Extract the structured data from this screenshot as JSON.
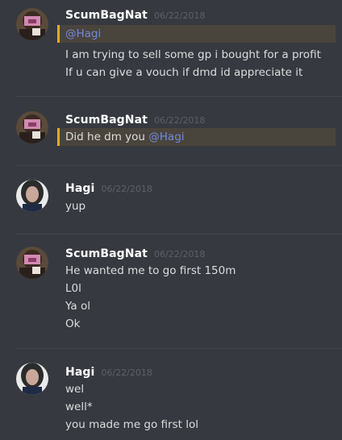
{
  "messages": [
    {
      "author": "ScumBagNat",
      "timestamp": "06/22/2018",
      "mention": "@Hagi",
      "lines": [
        "I am trying to sell some gp i bought for a profit",
        "If u can give a vouch if dmd id appreciate it"
      ]
    },
    {
      "author": "ScumBagNat",
      "timestamp": "06/22/2018",
      "text": "Did he dm you ",
      "mention": "@Hagi"
    },
    {
      "author": "Hagi",
      "timestamp": "06/22/2018",
      "lines": [
        "yup"
      ]
    },
    {
      "author": "ScumBagNat",
      "timestamp": "06/22/2018",
      "lines": [
        "He wanted me to go first 150m",
        "L0l",
        "Ya ol",
        "Ok"
      ]
    },
    {
      "author": "Hagi",
      "timestamp": "06/22/2018",
      "lines": [
        "wel",
        "well*",
        "you made me go first lol"
      ]
    }
  ],
  "colors": {
    "background": "#36393f",
    "mention_highlight": "#49443c",
    "mention_bar": "#faa61a",
    "mention_text": "#7289da"
  }
}
